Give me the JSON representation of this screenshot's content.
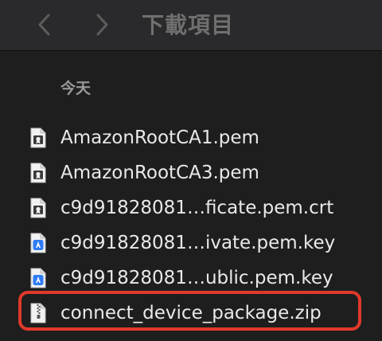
{
  "toolbar": {
    "title": "下載項目",
    "back_icon": "chevron-left-icon",
    "forward_icon": "chevron-right-icon"
  },
  "section": {
    "header": "今天"
  },
  "files": [
    {
      "name": "AmazonRootCA1.pem",
      "icon": "certificate-file-icon"
    },
    {
      "name": "AmazonRootCA3.pem",
      "icon": "certificate-file-icon"
    },
    {
      "name": "c9d91828081…ficate.pem.crt",
      "icon": "certificate-file-icon"
    },
    {
      "name": "c9d91828081…ivate.pem.key",
      "icon": "key-file-icon"
    },
    {
      "name": "c9d91828081…ublic.pem.key",
      "icon": "key-file-icon"
    },
    {
      "name": "connect_device_package.zip",
      "icon": "zip-file-icon"
    }
  ],
  "colors": {
    "highlight": "#e0392b",
    "toolbar_bg": "#2a2a2c",
    "content_bg": "#1e1e1e"
  }
}
